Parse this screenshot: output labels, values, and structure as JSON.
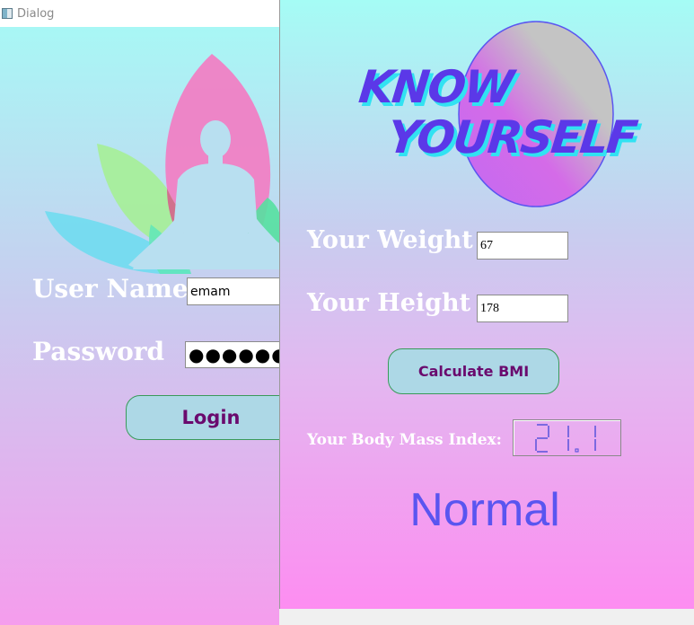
{
  "login_dialog": {
    "window_title": "Dialog",
    "username_label": "User Name",
    "username_value": "emam",
    "password_label": "Password",
    "password_value": "●●●●●●",
    "login_button_label": "Login"
  },
  "bmi_window": {
    "hero_line1": "KNOW",
    "hero_line2": "YOURSELF",
    "weight_label": "Your Weight",
    "weight_value": "67",
    "height_label": "Your Height",
    "height_value": "178",
    "calculate_button_label": "Calculate BMI",
    "bmi_label": "Your Body Mass Index:",
    "bmi_value": "21.1",
    "bmi_status": "Normal"
  },
  "colors": {
    "button_fill": "#add8e6",
    "button_text": "#6a0a6e",
    "status_text": "#5a55f0",
    "hero_text": "#5b38e8",
    "hero_shadow": "#31e2f2"
  },
  "icons": {
    "window_icon": "app-window-icon",
    "logo": "yoga-lotus-logo"
  }
}
